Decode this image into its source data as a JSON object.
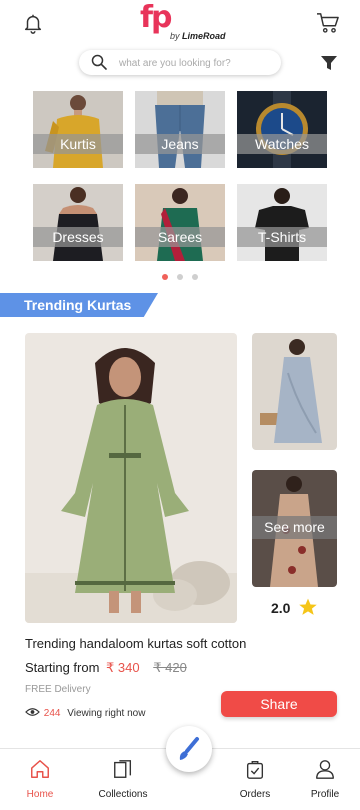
{
  "header": {
    "logo_main": "fp",
    "logo_by": "by",
    "logo_brand": "LimeRoad",
    "icons": [
      "bell-icon",
      "cart-icon"
    ]
  },
  "search": {
    "placeholder": "what are you looking for?",
    "value": ""
  },
  "categories": [
    {
      "label": "Kurtis"
    },
    {
      "label": "Jeans"
    },
    {
      "label": "Watches"
    },
    {
      "label": "Dresses"
    },
    {
      "label": "Sarees"
    },
    {
      "label": "T-Shirts"
    }
  ],
  "carousel": {
    "pages": 3,
    "active": 1
  },
  "trending": {
    "title": "Trending Kurtas",
    "see_more": "See more",
    "rating": "2.0",
    "product_title": "Trending handaloom kurtas soft cotton",
    "price_prefix": "Starting from",
    "price_now": "₹ 340",
    "price_old": "₹ 420",
    "delivery": "FREE Delivery",
    "views_count": "244",
    "views_text": "Viewing right now",
    "share_label": "Share"
  },
  "bottom_nav": [
    {
      "label": "Home",
      "icon": "home-icon",
      "active": true
    },
    {
      "label": "Collections",
      "icon": "collections-icon",
      "active": false
    },
    {
      "label": "Orders",
      "icon": "orders-icon",
      "active": false
    },
    {
      "label": "Profile",
      "icon": "profile-icon",
      "active": false
    }
  ],
  "colors": {
    "brand": "#e8345a",
    "accent": "#f04b47",
    "banner": "#5e92e6",
    "star": "#f5c518"
  }
}
